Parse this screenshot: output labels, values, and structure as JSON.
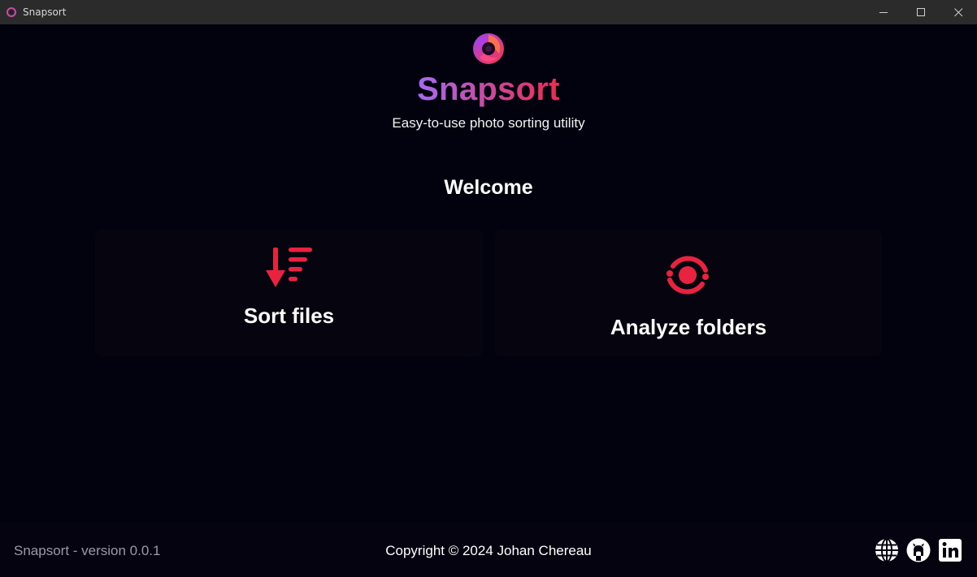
{
  "window": {
    "title": "Snapsort",
    "controls": {
      "minimize": "minimize-icon",
      "maximize": "maximize-icon",
      "close": "close-icon"
    }
  },
  "header": {
    "app_name": "Snapsort",
    "tagline": "Easy-to-use photo sorting utility",
    "brand_gradient": [
      "#a66bf2",
      "#ee2b4f"
    ]
  },
  "main": {
    "heading": "Welcome",
    "actions": [
      {
        "label": "Sort files",
        "icon": "sort-descending-icon"
      },
      {
        "label": "Analyze folders",
        "icon": "scan-target-icon"
      }
    ],
    "accent_color": "#e8223f"
  },
  "footer": {
    "version": "Snapsort - version 0.0.1",
    "copyright": "Copyright © 2024 Johan Chereau",
    "links": [
      "globe-icon",
      "github-icon",
      "linkedin-icon"
    ]
  }
}
